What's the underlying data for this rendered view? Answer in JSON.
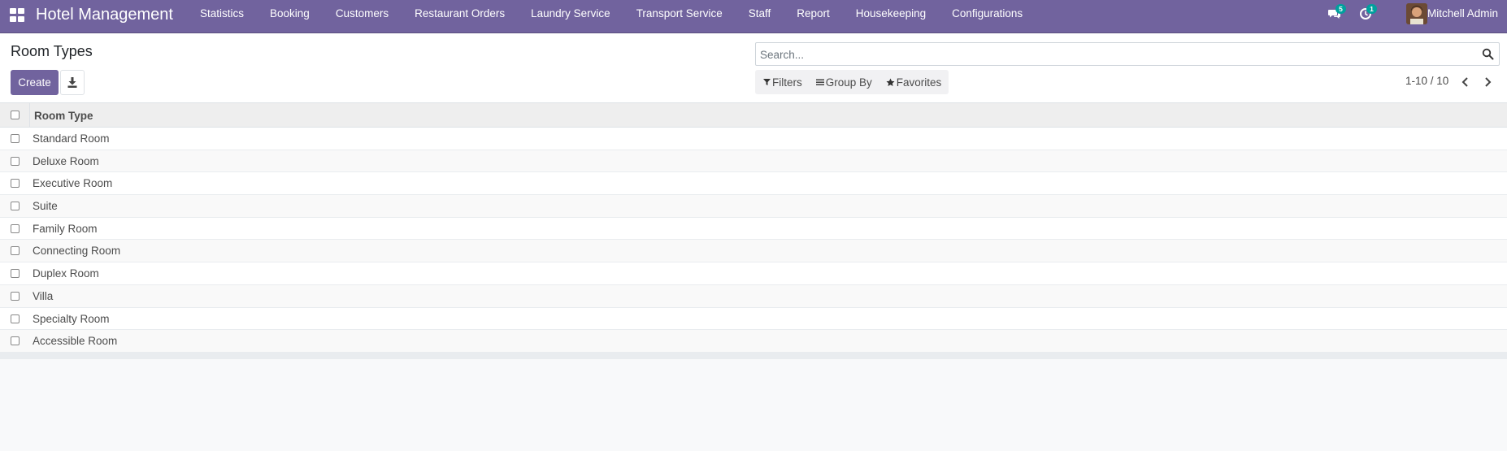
{
  "navbar": {
    "brand": "Hotel Management",
    "menu": [
      "Statistics",
      "Booking",
      "Customers",
      "Restaurant Orders",
      "Laundry Service",
      "Transport Service",
      "Staff",
      "Report",
      "Housekeeping",
      "Configurations"
    ],
    "messages_count": "5",
    "activities_count": "1",
    "user_name": "Mitchell Admin",
    "icons": {
      "apps": "apps-grid-icon",
      "messages": "chat-bubbles-icon",
      "activities": "clock-icon"
    },
    "color": "#71639e"
  },
  "control_panel": {
    "title": "Room Types",
    "create_label": "Create",
    "export_icon": "download-icon",
    "search_placeholder": "Search...",
    "filters_label": "Filters",
    "group_by_label": "Group By",
    "favorites_label": "Favorites",
    "pager_value": "1-10 / 10"
  },
  "list": {
    "column_header": "Room Type",
    "rows": [
      "Standard Room",
      "Deluxe Room",
      "Executive Room",
      "Suite",
      "Family Room",
      "Connecting Room",
      "Duplex Room",
      "Villa",
      "Specialty Room",
      "Accessible Room"
    ]
  }
}
